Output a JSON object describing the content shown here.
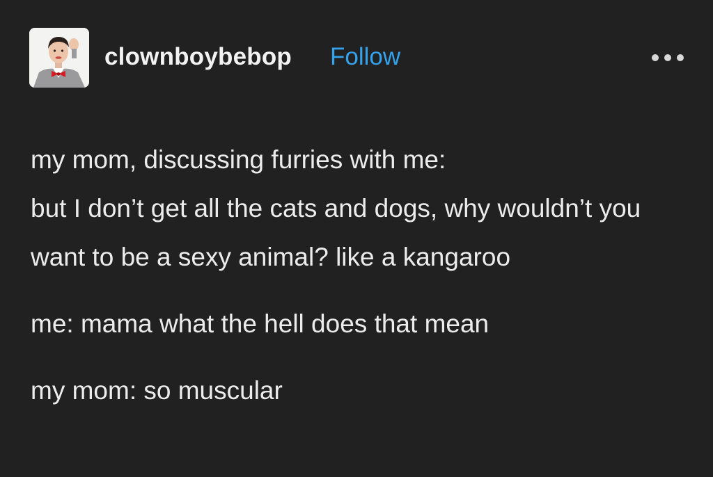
{
  "post": {
    "author": {
      "username": "clownboybebop",
      "avatar_icon": "avatar-man-red-bowtie-icon"
    },
    "follow_label": "Follow",
    "more_icon": "more-options-icon",
    "colors": {
      "background": "#212121",
      "text": "#ececec",
      "follow_link": "#33a3ee"
    },
    "content": {
      "line1": "my mom, discussing furries with me:",
      "line2": "but I don’t get all the cats and dogs, why wouldn’t you want to be a sexy animal? like a kangaroo",
      "line3": "me: mama what the hell does that mean",
      "line4": "my mom: so muscular"
    }
  }
}
